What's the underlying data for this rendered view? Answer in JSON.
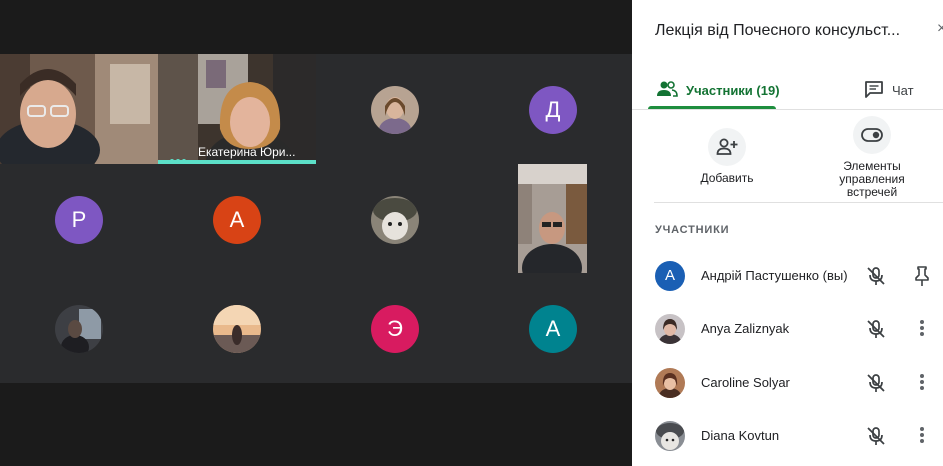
{
  "panel": {
    "title": "Лекція від Почесного консульст...",
    "close_glyph": "×",
    "tabs": [
      {
        "label": "Участники (19)",
        "icon": "people-icon",
        "active": true
      },
      {
        "label": "Чат",
        "icon": "chat-icon",
        "active": false
      }
    ],
    "actions": {
      "add_label": "Добавить",
      "controls_label_line1": "Элементы",
      "controls_label_line2": "управления",
      "controls_label_line3": "встречей"
    },
    "section_label": "УЧАСТНИКИ",
    "participants": [
      {
        "name": "Андрій Пастушенко (вы)",
        "avatar_letter": "А",
        "avatar_color": "#1a5fb4",
        "trailing": "pin-icon"
      },
      {
        "name": "Anya Zaliznyak",
        "avatar_letter": "",
        "avatar_color": "#6b5a58",
        "trailing": "more-vert-icon"
      },
      {
        "name": "Caroline Solyar",
        "avatar_letter": "",
        "avatar_color": "#7a4e3a",
        "trailing": "more-vert-icon"
      },
      {
        "name": "Diana Kovtun",
        "avatar_letter": "",
        "avatar_color": "#5a5f66",
        "trailing": "more-vert-icon"
      }
    ]
  },
  "grid": {
    "speaker_name": "Екатерина Юри...",
    "letters": [
      {
        "letter": "Д",
        "color": "#7e57c2"
      },
      {
        "letter": "Р",
        "color": "#7e57c2"
      },
      {
        "letter": "А",
        "color": "#d84315"
      },
      {
        "letter": "Э",
        "color": "#d81b60"
      },
      {
        "letter": "А",
        "color": "#00838f"
      }
    ]
  },
  "colors": {
    "accent_green": "#137333",
    "speaking_teal": "#5ce0c8",
    "stage_bg": "#202124"
  }
}
